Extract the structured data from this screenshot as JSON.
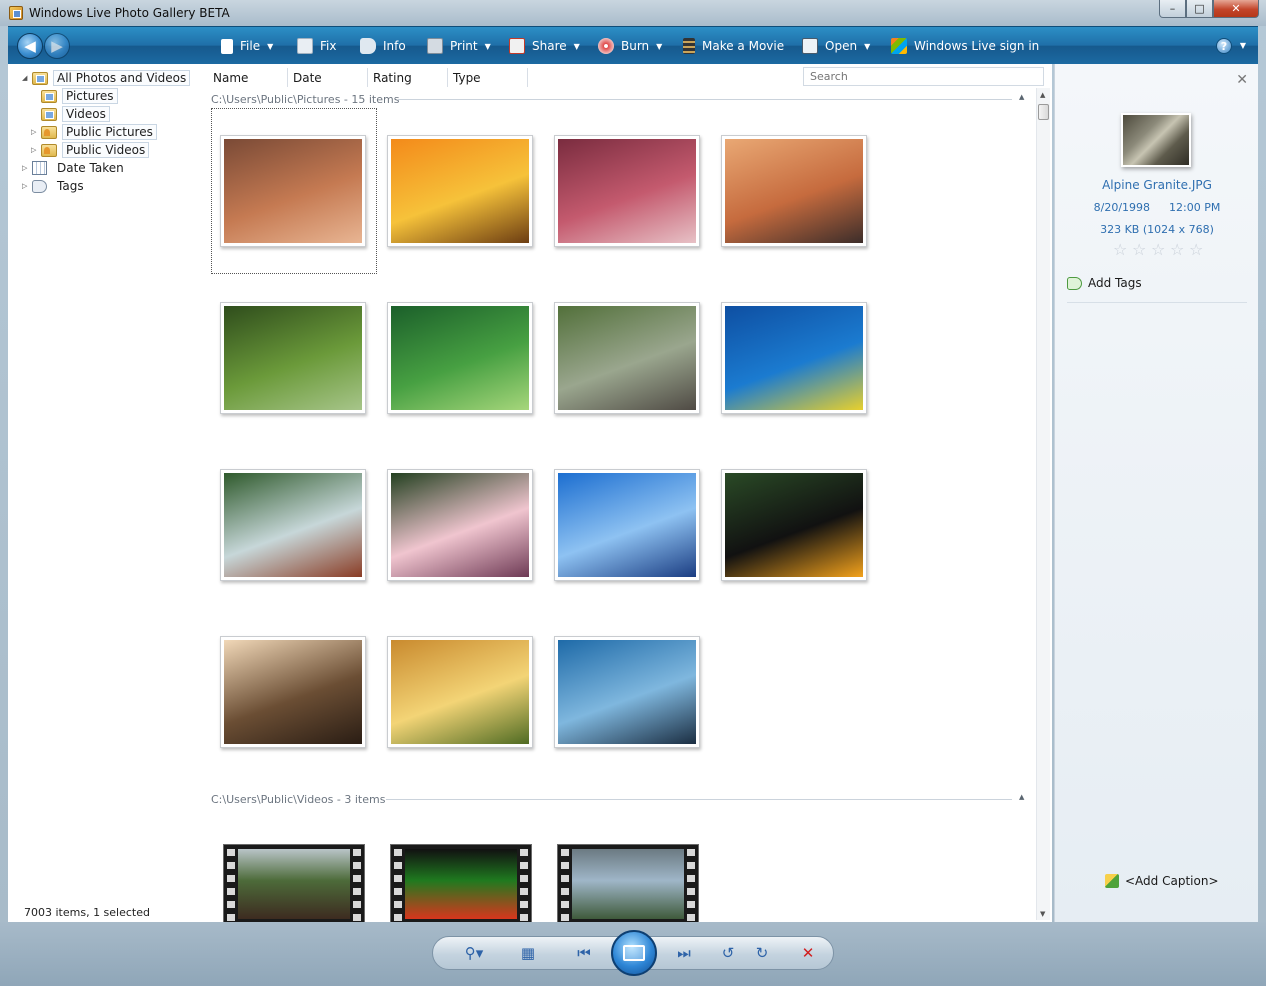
{
  "window": {
    "title": "Windows Live Photo Gallery BETA",
    "controls": {
      "minimize": "–",
      "maximize": "□",
      "close": "✕"
    }
  },
  "toolbar": {
    "items": [
      {
        "label": "File",
        "icon": "file-icon",
        "dropdown": true
      },
      {
        "label": "Fix",
        "icon": "fix-icon",
        "dropdown": false
      },
      {
        "label": "Info",
        "icon": "info-icon",
        "dropdown": false
      },
      {
        "label": "Print",
        "icon": "print-icon",
        "dropdown": true
      },
      {
        "label": "Share",
        "icon": "share-icon",
        "dropdown": true
      },
      {
        "label": "Burn",
        "icon": "burn-icon",
        "dropdown": true
      },
      {
        "label": "Make a Movie",
        "icon": "movie-icon",
        "dropdown": false
      },
      {
        "label": "Open",
        "icon": "open-icon",
        "dropdown": true
      },
      {
        "label": "Windows Live sign in",
        "icon": "windows-live-icon",
        "dropdown": false
      }
    ],
    "help": "?"
  },
  "tree": {
    "items": [
      {
        "label": "All Photos and Videos",
        "expander": "◢"
      },
      {
        "label": "Pictures",
        "expander": ""
      },
      {
        "label": "Videos",
        "expander": ""
      },
      {
        "label": "Public Pictures",
        "expander": "▷"
      },
      {
        "label": "Public Videos",
        "expander": "▷"
      },
      {
        "label": "Date Taken",
        "expander": "▷"
      },
      {
        "label": "Tags",
        "expander": "▷"
      }
    ]
  },
  "status": {
    "text": "7003 items, 1 selected"
  },
  "columns": {
    "name": "Name",
    "date": "Date",
    "rating": "Rating",
    "type": "Type"
  },
  "search": {
    "placeholder": "Search"
  },
  "groups": {
    "pictures": {
      "label": "C:\\Users\\Public\\Pictures - 15 items"
    },
    "videos": {
      "label": "C:\\Users\\Public\\Videos - 3 items"
    }
  },
  "photos": [
    {
      "name": "desert-monuments",
      "colors": [
        "#7a4a36",
        "#c57a52",
        "#e8b593"
      ]
    },
    {
      "name": "orange-flowers",
      "colors": [
        "#f38a1a",
        "#f6c23a",
        "#6c3d12"
      ]
    },
    {
      "name": "frosted-leaves",
      "colors": [
        "#7a2c3f",
        "#c45a6e",
        "#e7c1c6"
      ]
    },
    {
      "name": "desert-oryx",
      "colors": [
        "#e9a874",
        "#c66b3e",
        "#3c2d2a"
      ]
    },
    {
      "name": "forest-path",
      "colors": [
        "#2f4d1c",
        "#6b9a3a",
        "#a7c58a"
      ]
    },
    {
      "name": "green-leaves",
      "colors": [
        "#1b5f2a",
        "#47a042",
        "#a6d67b"
      ]
    },
    {
      "name": "stream-meadow",
      "colors": [
        "#52703a",
        "#9aa68e",
        "#4f4a44"
      ]
    },
    {
      "name": "sea-turtle",
      "colors": [
        "#0e4fa2",
        "#1b7bd0",
        "#e8d02d"
      ]
    },
    {
      "name": "waterfall",
      "colors": [
        "#2f5a2c",
        "#c7d7d9",
        "#8a3c25"
      ]
    },
    {
      "name": "plumeria",
      "colors": [
        "#234020",
        "#f0c5cf",
        "#6e3a55"
      ]
    },
    {
      "name": "ocean-pier",
      "colors": [
        "#1c6ed0",
        "#8ec2f2",
        "#1b3d82"
      ]
    },
    {
      "name": "toucan",
      "colors": [
        "#2a4a26",
        "#111111",
        "#f3a21c"
      ]
    },
    {
      "name": "tree-silhouette",
      "colors": [
        "#f1d8b8",
        "#6b4e34",
        "#2a1d14"
      ]
    },
    {
      "name": "autumn-tree",
      "colors": [
        "#c98a2e",
        "#f3d476",
        "#4f6b23"
      ]
    },
    {
      "name": "whale-tail",
      "colors": [
        "#1e6aa8",
        "#7fb7de",
        "#1b2e42"
      ]
    }
  ],
  "videos": [
    {
      "name": "bear-river",
      "colors": [
        "#4d6b3a",
        "#3d2b20",
        "#b9c4c8"
      ]
    },
    {
      "name": "butterfly-flower",
      "colors": [
        "#1f7a1f",
        "#d8361d",
        "#111111"
      ]
    },
    {
      "name": "mountain-lake",
      "colors": [
        "#9fb6c8",
        "#3f5a3b",
        "#6b7a82"
      ]
    }
  ],
  "info_pane": {
    "filename": "Alpine Granite.JPG",
    "date": "8/20/1998",
    "time": "12:00 PM",
    "size": "323 KB (1024 x 768)",
    "rating": 0,
    "rating_max": 5,
    "add_tags": "Add Tags",
    "add_caption": "<Add Caption>"
  },
  "bottom_controls": [
    "zoom-icon",
    "details-view-icon",
    "previous-icon",
    "slideshow-icon",
    "next-icon",
    "rotate-left-icon",
    "rotate-right-icon",
    "delete-icon"
  ]
}
